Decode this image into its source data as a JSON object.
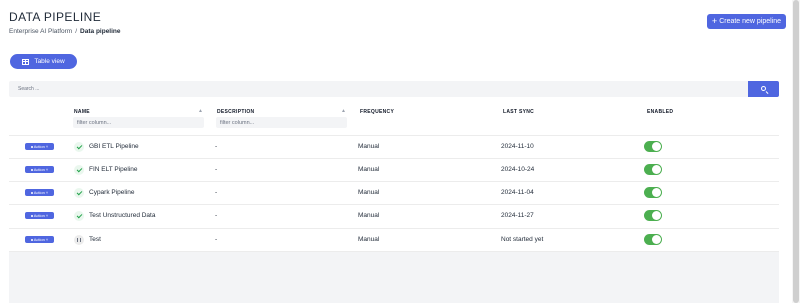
{
  "page": {
    "title": "DATA PIPELINE"
  },
  "breadcrumb": {
    "parent": "Enterprise AI Platform",
    "separator": "/",
    "current": "Data pipeline"
  },
  "create_button": {
    "icon": "plus",
    "label": "Create new pipeline"
  },
  "view_button": {
    "icon": "table-icon",
    "label": "Table view"
  },
  "search": {
    "placeholder": "Search ...",
    "button_icon": "search-icon"
  },
  "table": {
    "columns": [
      "NAME",
      "DESCRIPTION",
      "FREQUENCY",
      "LAST SYNC",
      "ENABLED"
    ],
    "filter_placeholder": "filter column...",
    "action_label": "Action",
    "rows": [
      {
        "status": "check",
        "name": "GBI ETL Pipeline",
        "description": "-",
        "frequency": "Manual",
        "last_sync": "2024-11-10",
        "enabled": true
      },
      {
        "status": "check",
        "name": "FIN ELT Pipeline",
        "description": "-",
        "frequency": "Manual",
        "last_sync": "2024-10-24",
        "enabled": true
      },
      {
        "status": "check",
        "name": "Cypark Pipeline",
        "description": "-",
        "frequency": "Manual",
        "last_sync": "2024-11-04",
        "enabled": true
      },
      {
        "status": "check",
        "name": "Test Unstructured Data",
        "description": "-",
        "frequency": "Manual",
        "last_sync": "2024-11-27",
        "enabled": true
      },
      {
        "status": "pause",
        "name": "Test",
        "description": "-",
        "frequency": "Manual",
        "last_sync": "Not started yet",
        "enabled": true
      }
    ]
  },
  "colors": {
    "accent": "#4f66e0",
    "toggle_on": "#4caf50",
    "success": "#22a34a"
  }
}
